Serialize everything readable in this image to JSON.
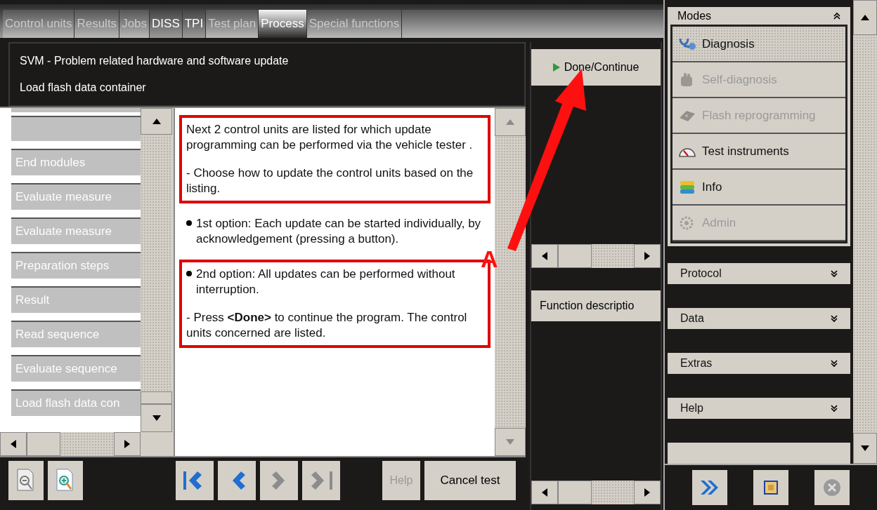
{
  "tabs": [
    {
      "label": "Control units",
      "selected": false,
      "disabled": true
    },
    {
      "label": "Results",
      "selected": false,
      "disabled": true
    },
    {
      "label": "Jobs",
      "selected": false,
      "disabled": true
    },
    {
      "label": "DISS",
      "selected": false,
      "disabled": false
    },
    {
      "label": "TPI",
      "selected": false,
      "disabled": false
    },
    {
      "label": "Test plan",
      "selected": false,
      "disabled": true
    },
    {
      "label": "Process",
      "selected": true,
      "disabled": false
    },
    {
      "label": "Special functions",
      "selected": false,
      "disabled": true
    }
  ],
  "header": {
    "title": "SVM - Problem related hardware and software update",
    "subtitle": "Load flash data container"
  },
  "steps": [
    {
      "label": "End modules"
    },
    {
      "label": "Evaluate measure"
    },
    {
      "label": "Evaluate measure"
    },
    {
      "label": "Preparation steps"
    },
    {
      "label": "Result"
    },
    {
      "label": "Read sequence"
    },
    {
      "label": "Evaluate sequence"
    },
    {
      "label": "Load flash data con"
    }
  ],
  "content": [
    {
      "highlighted": true,
      "paragraphs": [
        {
          "bullet": false,
          "text": "Next 2 control units are listed for which update programming can be performed via the vehicle tester ."
        },
        {
          "bullet": false,
          "text": "- Choose how to update the control units based on the listing."
        }
      ]
    },
    {
      "highlighted": false,
      "paragraphs": [
        {
          "bullet": true,
          "text": "1st option: Each update can be started individually, by acknowledgement (pressing a button)."
        }
      ]
    },
    {
      "highlighted": true,
      "paragraphs": [
        {
          "bullet": true,
          "text": "2nd option: All updates can be performed without interruption."
        },
        {
          "bullet": false,
          "text": "- Press **<Done>** to continue the program. The control units concerned are listed."
        }
      ]
    }
  ],
  "nav_buttons": [
    {
      "kind": "first",
      "disabled": false
    },
    {
      "kind": "previous",
      "disabled": false
    },
    {
      "kind": "next",
      "disabled": true
    },
    {
      "kind": "last",
      "disabled": true
    }
  ],
  "help_button": {
    "label": "Help",
    "disabled": true
  },
  "cancel_button": {
    "label": "Cancel test"
  },
  "done_button": {
    "label": "Done/Continue"
  },
  "function_button": {
    "label": "Function descriptio"
  },
  "annotation": {
    "label": "A"
  },
  "modes": {
    "title": "Modes",
    "items": [
      {
        "label": "Diagnosis",
        "kind": "diagnosis",
        "selected": true,
        "disabled": false
      },
      {
        "label": "Self-diagnosis",
        "kind": "self",
        "selected": false,
        "disabled": true
      },
      {
        "label": "Flash reprogramming",
        "kind": "flash",
        "selected": false,
        "disabled": true
      },
      {
        "label": "Test instruments",
        "kind": "gauge",
        "selected": false,
        "disabled": false
      },
      {
        "label": "Info",
        "kind": "info",
        "selected": false,
        "disabled": false
      },
      {
        "label": "Admin",
        "kind": "admin",
        "selected": false,
        "disabled": true
      }
    ]
  },
  "sections": [
    {
      "label": "Protocol"
    },
    {
      "label": "Data"
    },
    {
      "label": "Extras"
    },
    {
      "label": "Help"
    }
  ]
}
